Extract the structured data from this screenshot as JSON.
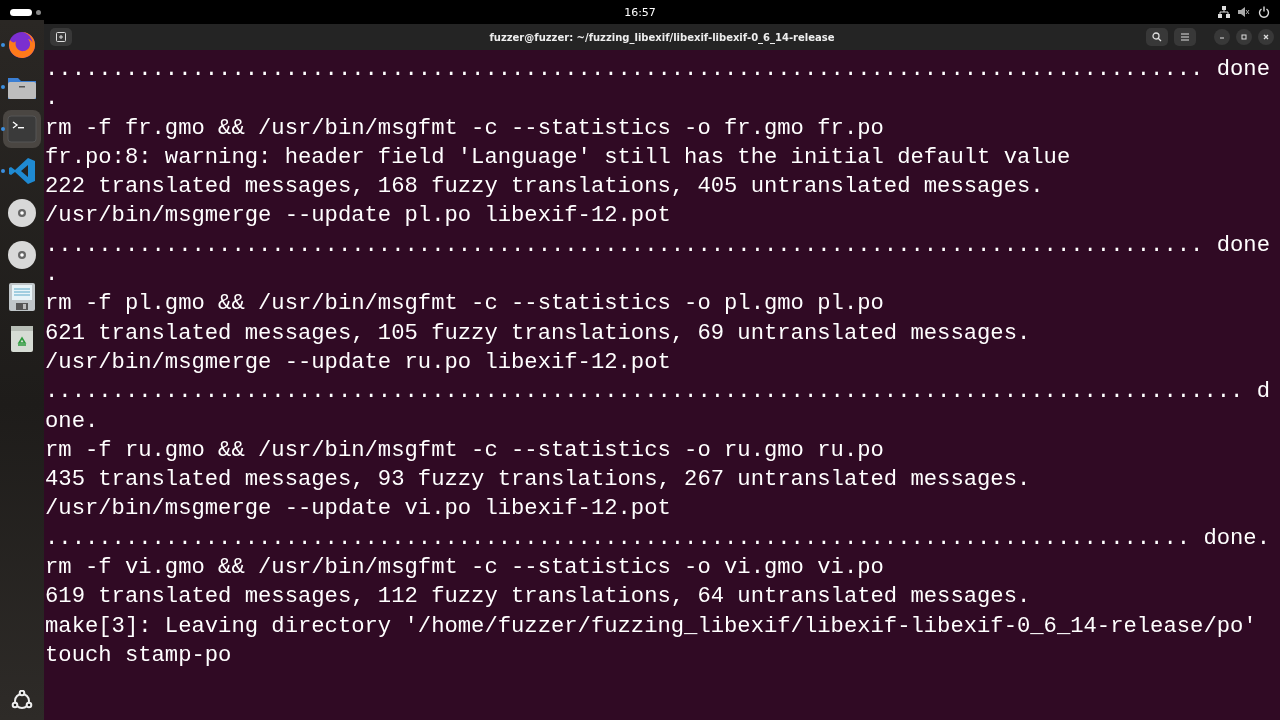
{
  "top_bar": {
    "clock": "16:57"
  },
  "dock": {
    "items": [
      {
        "kind": "browser",
        "running": true,
        "selected": false
      },
      {
        "kind": "files",
        "running": true,
        "selected": false
      },
      {
        "kind": "terminal",
        "running": true,
        "selected": true
      },
      {
        "kind": "editor",
        "running": true,
        "selected": false
      },
      {
        "kind": "disc",
        "running": false,
        "selected": false
      },
      {
        "kind": "disc",
        "running": false,
        "selected": false
      },
      {
        "kind": "document",
        "running": false,
        "selected": false
      },
      {
        "kind": "trash",
        "running": false,
        "selected": false
      }
    ]
  },
  "window": {
    "title": "fuzzer@fuzzer: ~/fuzzing_libexif/libexif-libexif-0_6_14-release"
  },
  "terminal": {
    "lines": [
      "....................................................................................... done",
      ".",
      "rm -f fr.gmo && /usr/bin/msgfmt -c --statistics -o fr.gmo fr.po",
      "fr.po:8: warning: header field 'Language' still has the initial default value",
      "222 translated messages, 168 fuzzy translations, 405 untranslated messages.",
      "/usr/bin/msgmerge --update pl.po libexif-12.pot",
      "....................................................................................... done",
      ".",
      "rm -f pl.gmo && /usr/bin/msgfmt -c --statistics -o pl.gmo pl.po",
      "621 translated messages, 105 fuzzy translations, 69 untranslated messages.",
      "/usr/bin/msgmerge --update ru.po libexif-12.pot",
      ".......................................................................................... d",
      "one.",
      "rm -f ru.gmo && /usr/bin/msgfmt -c --statistics -o ru.gmo ru.po",
      "435 translated messages, 93 fuzzy translations, 267 untranslated messages.",
      "/usr/bin/msgmerge --update vi.po libexif-12.pot",
      "...................................................................................... done.",
      "rm -f vi.gmo && /usr/bin/msgfmt -c --statistics -o vi.gmo vi.po",
      "619 translated messages, 112 fuzzy translations, 64 untranslated messages.",
      "make[3]: Leaving directory '/home/fuzzer/fuzzing_libexif/libexif-libexif-0_6_14-release/po'",
      "touch stamp-po"
    ]
  }
}
